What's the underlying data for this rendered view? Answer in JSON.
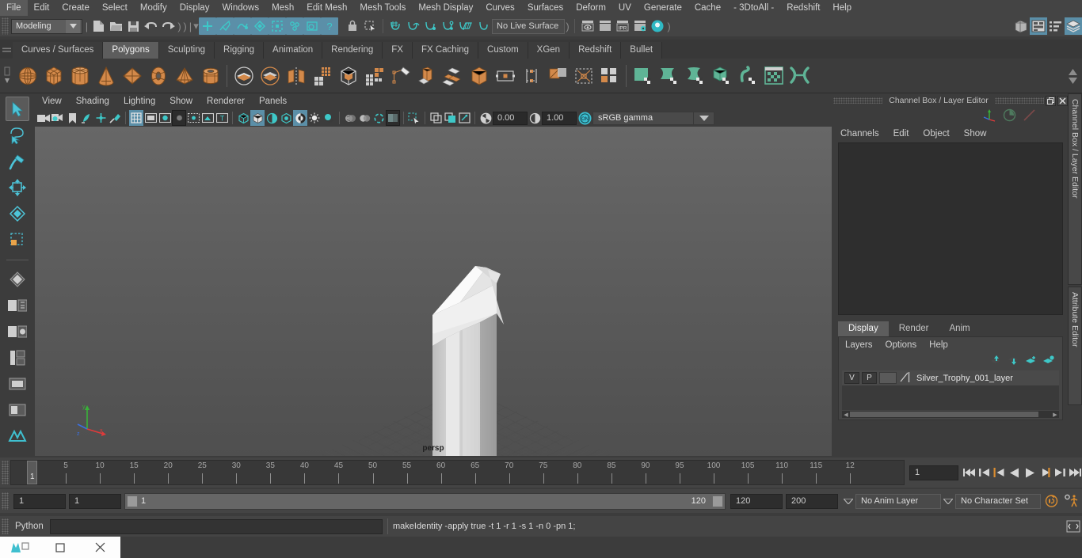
{
  "menubar": {
    "items": [
      "File",
      "Edit",
      "Create",
      "Select",
      "Modify",
      "Display",
      "Windows",
      "Mesh",
      "Edit Mesh",
      "Mesh Tools",
      "Mesh Display",
      "Curves",
      "Surfaces",
      "Deform",
      "UV",
      "Generate",
      "Cache",
      "- 3DtoAll -",
      "Redshift",
      "Help"
    ]
  },
  "statusline": {
    "mode": "Modeling",
    "live_surface": "No Live Surface"
  },
  "shelf": {
    "tabs": [
      "Curves / Surfaces",
      "Polygons",
      "Sculpting",
      "Rigging",
      "Animation",
      "Rendering",
      "FX",
      "FX Caching",
      "Custom",
      "XGen",
      "Redshift",
      "Bullet"
    ],
    "active_tab": "Polygons"
  },
  "viewport": {
    "menus": [
      "View",
      "Shading",
      "Lighting",
      "Show",
      "Renderer",
      "Panels"
    ],
    "exposure": "0.00",
    "gamma": "1.00",
    "color_profile": "sRGB gamma",
    "camera_label": "persp",
    "axis_x": "x",
    "axis_y": "y",
    "axis_z": "z"
  },
  "channelbox": {
    "panel_title": "Channel Box / Layer Editor",
    "menus": [
      "Channels",
      "Edit",
      "Object",
      "Show"
    ]
  },
  "layer_editor": {
    "tabs": [
      "Display",
      "Render",
      "Anim"
    ],
    "active_tab": "Display",
    "menus": [
      "Layers",
      "Options",
      "Help"
    ],
    "layers": [
      {
        "visibility": "V",
        "playback": "P",
        "name": "Silver_Trophy_001_layer"
      }
    ]
  },
  "vertical_tabs": [
    "Channel Box / Layer Editor",
    "Attribute Editor"
  ],
  "timeline": {
    "tick_labels": [
      "5",
      "10",
      "15",
      "20",
      "25",
      "30",
      "35",
      "40",
      "45",
      "50",
      "55",
      "60",
      "65",
      "70",
      "75",
      "80",
      "85",
      "90",
      "95",
      "100",
      "105",
      "110",
      "115",
      "12"
    ],
    "current_frame_marker": "1",
    "current_frame_field": "1"
  },
  "range": {
    "start": "1",
    "anim_start": "1",
    "range_start": "1",
    "range_end": "120",
    "anim_end": "120",
    "end": "200",
    "anim_layer": "No Anim Layer",
    "character_set": "No Character Set"
  },
  "command_line": {
    "language": "Python",
    "input_value": "",
    "output": "makeIdentity -apply true -t 1 -r 1 -s 1 -n 0 -pn 1;"
  },
  "colors": {
    "accent_blue": "#5b8fa8",
    "shelf_orange": "#d99049",
    "shelf_green": "#6dbd9c",
    "panel_bg": "#3c3c3c",
    "viewport_bg": "#5c5c5c"
  },
  "icon_names": {
    "new_scene": "new-scene-icon",
    "open_scene": "open-scene-icon",
    "save_scene": "save-scene-icon",
    "undo": "undo-icon",
    "redo": "redo-icon",
    "select_tool": "select-tool-icon",
    "lasso_tool": "lasso-select-icon",
    "paint_select": "paint-select-icon",
    "move_tool": "move-tool-icon",
    "rotate_tool": "rotate-tool-icon",
    "scale_tool": "scale-tool-icon"
  }
}
